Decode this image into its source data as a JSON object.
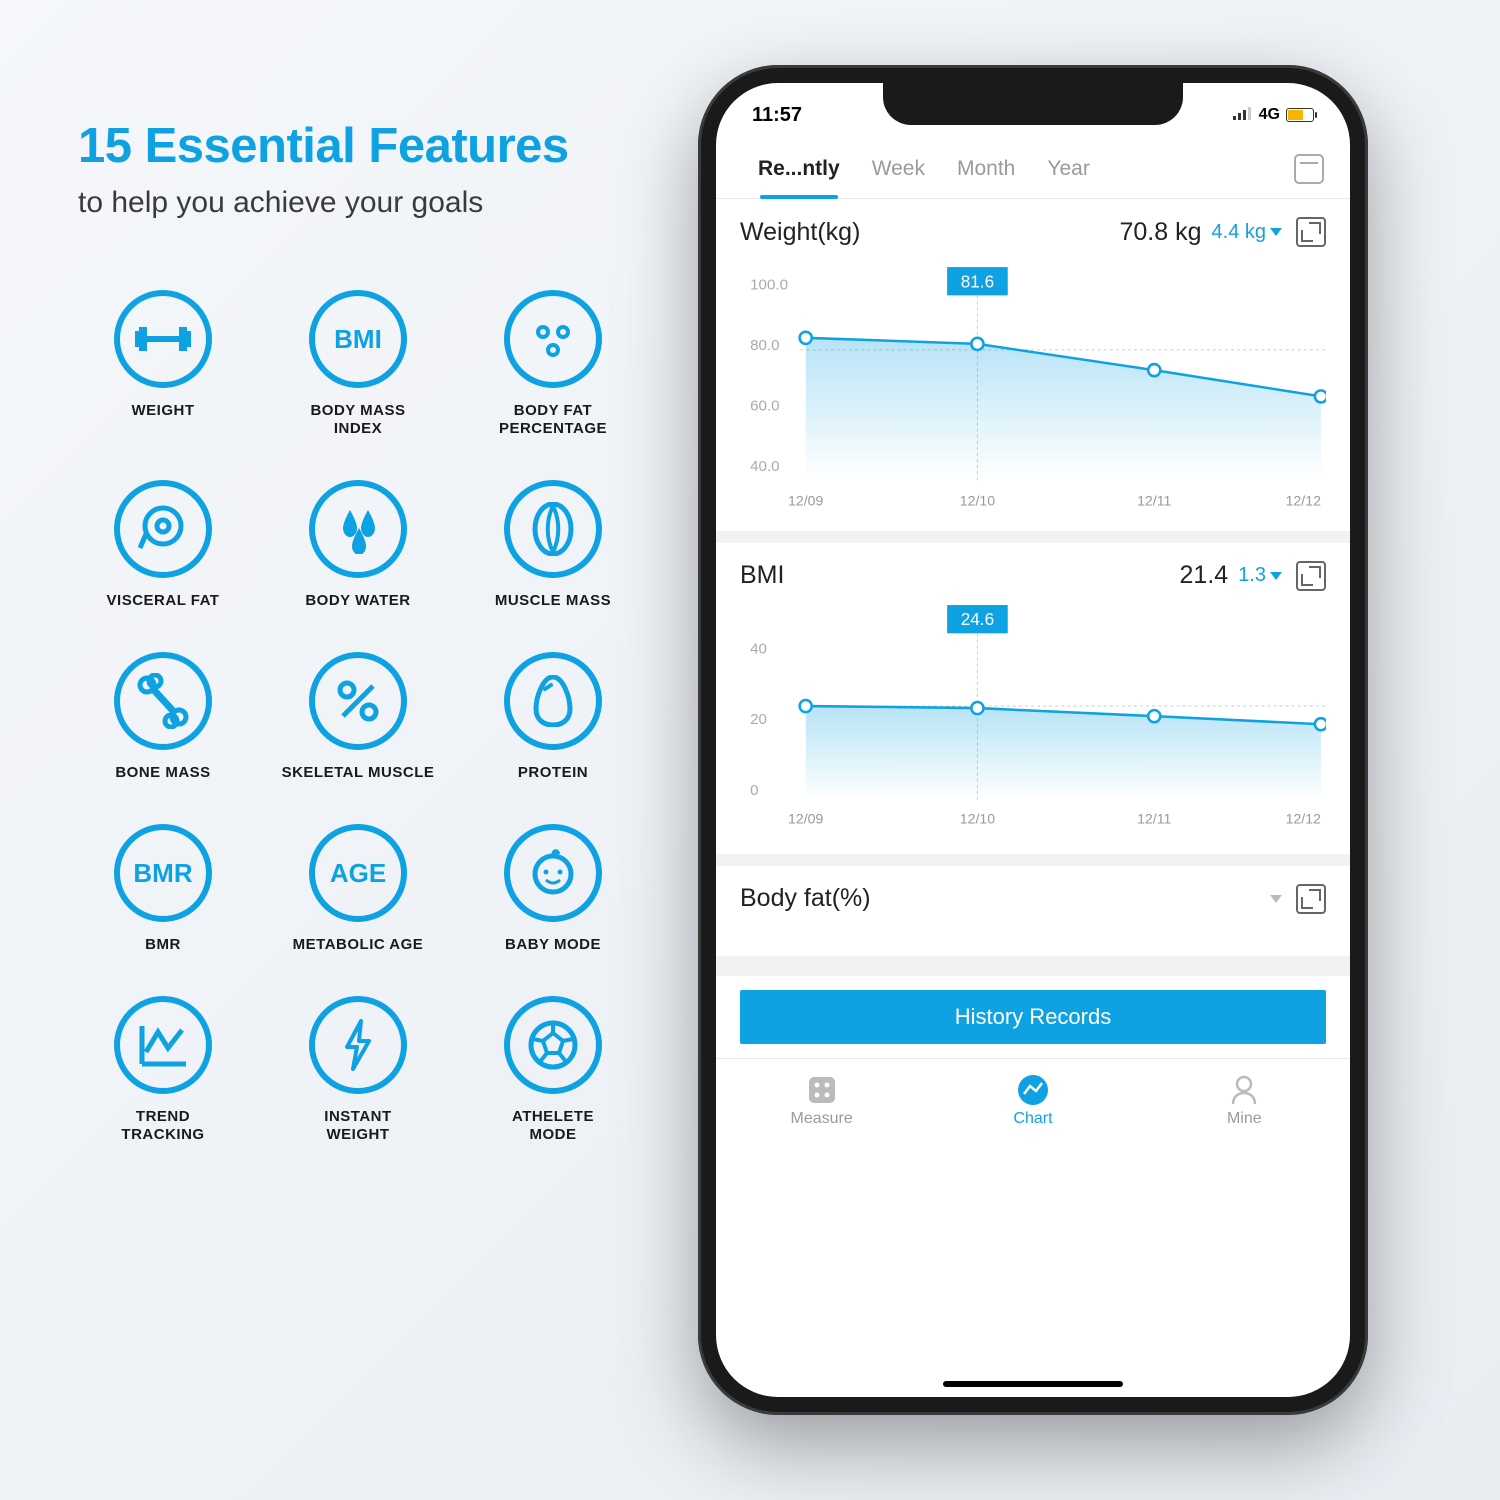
{
  "marketing": {
    "headline": "15 Essential Features",
    "subhead": "to help you achieve your goals"
  },
  "features": [
    {
      "label": "WEIGHT",
      "icon": "barbell"
    },
    {
      "label": "BODY MASS INDEX",
      "icon": "bmi",
      "text": "BMI"
    },
    {
      "label": "BODY FAT PERCENTAGE",
      "icon": "dots"
    },
    {
      "label": "VISCERAL FAT",
      "icon": "tape"
    },
    {
      "label": "BODY WATER",
      "icon": "drops"
    },
    {
      "label": "MUSCLE MASS",
      "icon": "muscle"
    },
    {
      "label": "BONE MASS",
      "icon": "bone"
    },
    {
      "label": "SKELETAL MUSCLE",
      "icon": "percent"
    },
    {
      "label": "PROTEIN",
      "icon": "egg"
    },
    {
      "label": "BMR",
      "icon": "bmr",
      "text": "BMR"
    },
    {
      "label": "METABOLIC AGE",
      "icon": "age",
      "text": "AGE"
    },
    {
      "label": "BABY MODE",
      "icon": "baby"
    },
    {
      "label": "TREND TRACKING",
      "icon": "trend"
    },
    {
      "label": "INSTANT WEIGHT",
      "icon": "bolt"
    },
    {
      "label": "ATHELETE MODE",
      "icon": "soccer"
    }
  ],
  "status": {
    "time": "11:57",
    "network": "4G"
  },
  "tabs": [
    {
      "label": "Re...ntly",
      "active": true
    },
    {
      "label": "Week"
    },
    {
      "label": "Month"
    },
    {
      "label": "Year"
    }
  ],
  "metrics": {
    "weight": {
      "title": "Weight(kg)",
      "value": "70.8 kg",
      "delta": "4.4 kg"
    },
    "bmi": {
      "title": "BMI",
      "value": "21.4",
      "delta": "1.3"
    },
    "bodyfat": {
      "title": "Body fat(%)"
    }
  },
  "chart_data": [
    {
      "type": "line",
      "title": "Weight(kg)",
      "x": [
        "12/09",
        "12/10",
        "12/11",
        "12/12"
      ],
      "values": [
        83.0,
        81.6,
        76.0,
        70.8
      ],
      "highlighted_label": "81.6",
      "highlighted_x": "12/10",
      "ylabel": "kg",
      "ylim": [
        40,
        100
      ],
      "yticks": [
        40.0,
        60.0,
        80.0,
        100.0
      ]
    },
    {
      "type": "line",
      "title": "BMI",
      "x": [
        "12/09",
        "12/10",
        "12/11",
        "12/12"
      ],
      "values": [
        25.0,
        24.6,
        23.0,
        21.4
      ],
      "highlighted_label": "24.6",
      "highlighted_x": "12/10",
      "ylabel": "",
      "ylim": [
        0,
        45
      ],
      "yticks": [
        0,
        20,
        40
      ]
    }
  ],
  "history_btn": "History Records",
  "nav": [
    {
      "label": "Measure",
      "icon": "dice"
    },
    {
      "label": "Chart",
      "icon": "chart",
      "active": true
    },
    {
      "label": "Mine",
      "icon": "user"
    }
  ],
  "colors": {
    "accent": "#0fa2e2"
  }
}
